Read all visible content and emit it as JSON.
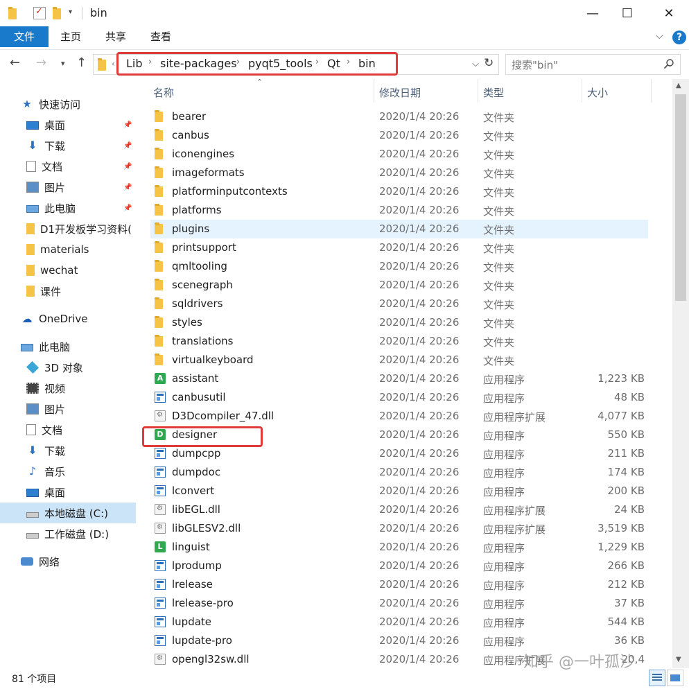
{
  "window": {
    "title": "bin",
    "controls": {
      "minimize": "—",
      "maximize": "☐",
      "close": "✕"
    }
  },
  "ribbon": {
    "tabs": [
      "文件",
      "主页",
      "共享",
      "查看"
    ],
    "help": "?"
  },
  "address": {
    "crumbs": [
      "Lib",
      "site-packages",
      "pyqt5_tools",
      "Qt",
      "bin"
    ],
    "search_placeholder": "搜索\"bin\""
  },
  "nav": {
    "quick_access": "快速访问",
    "items": [
      {
        "label": "快速访问",
        "icon": "star-icon"
      },
      {
        "label": "桌面",
        "icon": "desktop-icon",
        "pinned": true
      },
      {
        "label": "下载",
        "icon": "download-icon",
        "pinned": true
      },
      {
        "label": "文档",
        "icon": "document-icon",
        "pinned": true
      },
      {
        "label": "图片",
        "icon": "picture-icon",
        "pinned": true
      },
      {
        "label": "此电脑",
        "icon": "computer-icon",
        "pinned": true
      },
      {
        "label": "D1开发板学习资料(",
        "icon": "folder-icon"
      },
      {
        "label": "materials",
        "icon": "folder-icon"
      },
      {
        "label": "wechat",
        "icon": "folder-icon"
      },
      {
        "label": "课件",
        "icon": "folder-icon"
      },
      {
        "label": "OneDrive",
        "icon": "cloud-icon"
      },
      {
        "label": "此电脑",
        "icon": "computer-icon"
      },
      {
        "label": "3D 对象",
        "icon": "3d-objects-icon"
      },
      {
        "label": "视频",
        "icon": "video-icon"
      },
      {
        "label": "图片",
        "icon": "picture-icon"
      },
      {
        "label": "文档",
        "icon": "document-icon"
      },
      {
        "label": "下载",
        "icon": "download-icon"
      },
      {
        "label": "音乐",
        "icon": "music-icon"
      },
      {
        "label": "桌面",
        "icon": "desktop-icon"
      },
      {
        "label": "本地磁盘 (C:)",
        "icon": "drive-icon",
        "selected": true
      },
      {
        "label": "工作磁盘 (D:)",
        "icon": "drive-icon"
      },
      {
        "label": "网络",
        "icon": "network-icon"
      }
    ]
  },
  "columns": {
    "name": "名称",
    "date": "修改日期",
    "type": "类型",
    "size": "大小"
  },
  "files": [
    {
      "name": "bearer",
      "date": "2020/1/4 20:26",
      "type": "文件夹",
      "size": "",
      "icon": "folder"
    },
    {
      "name": "canbus",
      "date": "2020/1/4 20:26",
      "type": "文件夹",
      "size": "",
      "icon": "folder"
    },
    {
      "name": "iconengines",
      "date": "2020/1/4 20:26",
      "type": "文件夹",
      "size": "",
      "icon": "folder"
    },
    {
      "name": "imageformats",
      "date": "2020/1/4 20:26",
      "type": "文件夹",
      "size": "",
      "icon": "folder"
    },
    {
      "name": "platforminputcontexts",
      "date": "2020/1/4 20:26",
      "type": "文件夹",
      "size": "",
      "icon": "folder"
    },
    {
      "name": "platforms",
      "date": "2020/1/4 20:26",
      "type": "文件夹",
      "size": "",
      "icon": "folder"
    },
    {
      "name": "plugins",
      "date": "2020/1/4 20:26",
      "type": "文件夹",
      "size": "",
      "icon": "folder",
      "hover": true
    },
    {
      "name": "printsupport",
      "date": "2020/1/4 20:26",
      "type": "文件夹",
      "size": "",
      "icon": "folder"
    },
    {
      "name": "qmltooling",
      "date": "2020/1/4 20:26",
      "type": "文件夹",
      "size": "",
      "icon": "folder"
    },
    {
      "name": "scenegraph",
      "date": "2020/1/4 20:26",
      "type": "文件夹",
      "size": "",
      "icon": "folder"
    },
    {
      "name": "sqldrivers",
      "date": "2020/1/4 20:26",
      "type": "文件夹",
      "size": "",
      "icon": "folder"
    },
    {
      "name": "styles",
      "date": "2020/1/4 20:26",
      "type": "文件夹",
      "size": "",
      "icon": "folder"
    },
    {
      "name": "translations",
      "date": "2020/1/4 20:26",
      "type": "文件夹",
      "size": "",
      "icon": "folder"
    },
    {
      "name": "virtualkeyboard",
      "date": "2020/1/4 20:26",
      "type": "文件夹",
      "size": "",
      "icon": "folder"
    },
    {
      "name": "assistant",
      "date": "2020/1/4 20:26",
      "type": "应用程序",
      "size": "1,223 KB",
      "icon": "app-a"
    },
    {
      "name": "canbusutil",
      "date": "2020/1/4 20:26",
      "type": "应用程序",
      "size": "48 KB",
      "icon": "exe"
    },
    {
      "name": "D3Dcompiler_47.dll",
      "date": "2020/1/4 20:26",
      "type": "应用程序扩展",
      "size": "4,077 KB",
      "icon": "dll"
    },
    {
      "name": "designer",
      "date": "2020/1/4 20:26",
      "type": "应用程序",
      "size": "550 KB",
      "icon": "app-d"
    },
    {
      "name": "dumpcpp",
      "date": "2020/1/4 20:26",
      "type": "应用程序",
      "size": "211 KB",
      "icon": "exe"
    },
    {
      "name": "dumpdoc",
      "date": "2020/1/4 20:26",
      "type": "应用程序",
      "size": "174 KB",
      "icon": "exe"
    },
    {
      "name": "lconvert",
      "date": "2020/1/4 20:26",
      "type": "应用程序",
      "size": "200 KB",
      "icon": "exe"
    },
    {
      "name": "libEGL.dll",
      "date": "2020/1/4 20:26",
      "type": "应用程序扩展",
      "size": "24 KB",
      "icon": "dll"
    },
    {
      "name": "libGLESV2.dll",
      "date": "2020/1/4 20:26",
      "type": "应用程序扩展",
      "size": "3,519 KB",
      "icon": "dll"
    },
    {
      "name": "linguist",
      "date": "2020/1/4 20:26",
      "type": "应用程序",
      "size": "1,229 KB",
      "icon": "app-l"
    },
    {
      "name": "lprodump",
      "date": "2020/1/4 20:26",
      "type": "应用程序",
      "size": "266 KB",
      "icon": "exe"
    },
    {
      "name": "lrelease",
      "date": "2020/1/4 20:26",
      "type": "应用程序",
      "size": "212 KB",
      "icon": "exe"
    },
    {
      "name": "lrelease-pro",
      "date": "2020/1/4 20:26",
      "type": "应用程序",
      "size": "37 KB",
      "icon": "exe"
    },
    {
      "name": "lupdate",
      "date": "2020/1/4 20:26",
      "type": "应用程序",
      "size": "544 KB",
      "icon": "exe"
    },
    {
      "name": "lupdate-pro",
      "date": "2020/1/4 20:26",
      "type": "应用程序",
      "size": "36 KB",
      "icon": "exe"
    },
    {
      "name": "opengl32sw.dll",
      "date": "2020/1/4 20:26",
      "type": "应用程序扩展",
      "size": "20,4",
      "icon": "dll"
    }
  ],
  "status": {
    "count": "81 个项目"
  },
  "watermark": "知乎 @一叶孤沙",
  "colors": {
    "accent": "#1979ca",
    "highlight_box": "#e03a3a",
    "selected_nav": "#cce4f7",
    "hover_row": "#e5f3ff"
  }
}
